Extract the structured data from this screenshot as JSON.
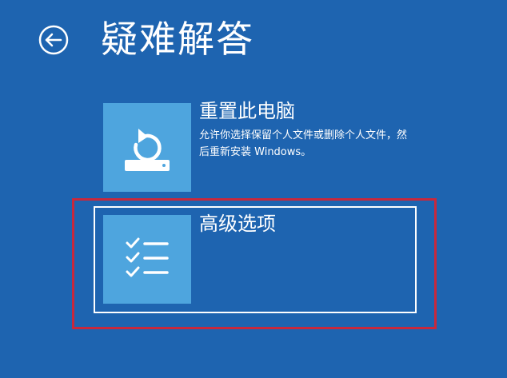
{
  "page": {
    "title": "疑难解答",
    "background_color": "#1e64b0"
  },
  "back_button": {
    "icon": "back-arrow-icon"
  },
  "options": {
    "reset": {
      "title": "重置此电脑",
      "description": "允许你选择保留个人文件或删除个人文件，然后重新安装 Windows。",
      "icon": "reset-pc-icon",
      "tile_color": "#4ea5de"
    },
    "advanced": {
      "title": "高级选项",
      "icon": "checklist-icon",
      "tile_color": "#4ea5de",
      "selected": true
    }
  },
  "annotation": {
    "highlight_color": "#c8283c"
  }
}
